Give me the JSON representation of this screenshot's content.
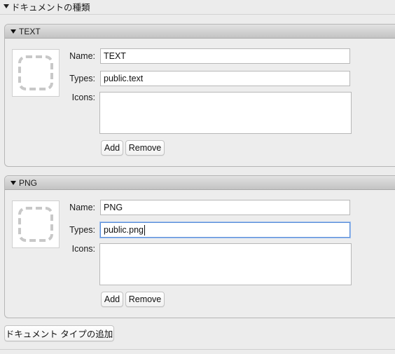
{
  "section": {
    "title": "ドキュメントの種類"
  },
  "documents": [
    {
      "header": "TEXT",
      "name_label": "Name:",
      "name_value": "TEXT",
      "types_label": "Types:",
      "types_value": "public.text",
      "icons_label": "Icons:",
      "add_label": "Add",
      "remove_label": "Remove"
    },
    {
      "header": "PNG",
      "name_label": "Name:",
      "name_value": "PNG",
      "types_label": "Types:",
      "types_value": "public.png",
      "icons_label": "Icons:",
      "add_label": "Add",
      "remove_label": "Remove"
    }
  ],
  "add_document_type_label": "ドキュメント タイプの追加",
  "colors": {
    "focus_ring": "#5b8ed8",
    "panel_header": "#c3c3c3"
  }
}
